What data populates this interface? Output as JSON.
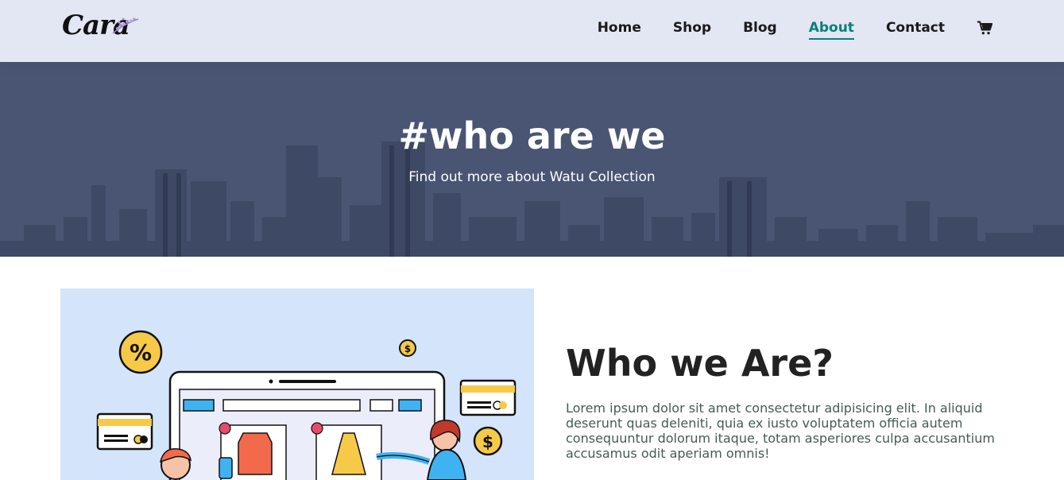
{
  "header": {
    "logo_text": "Cara",
    "nav": {
      "home": "Home",
      "shop": "Shop",
      "blog": "Blog",
      "about": "About",
      "contact": "Contact"
    },
    "active_nav": "About",
    "accent_color": "#088178",
    "cart_icon": "cart-icon"
  },
  "hero": {
    "title": "#who are we",
    "subtitle": "Find out more about Watu Collection"
  },
  "about": {
    "title": "Who we Are?",
    "paragraph": "Lorem ipsum dolor sit amet consectetur adipisicing elit. In aliquid deserunt quas deleniti, quia ex iusto voluptatem officia autem consequuntur dolorum itaque, totam asperiores culpa accusantium accusamus odit aperiam omnis!"
  }
}
